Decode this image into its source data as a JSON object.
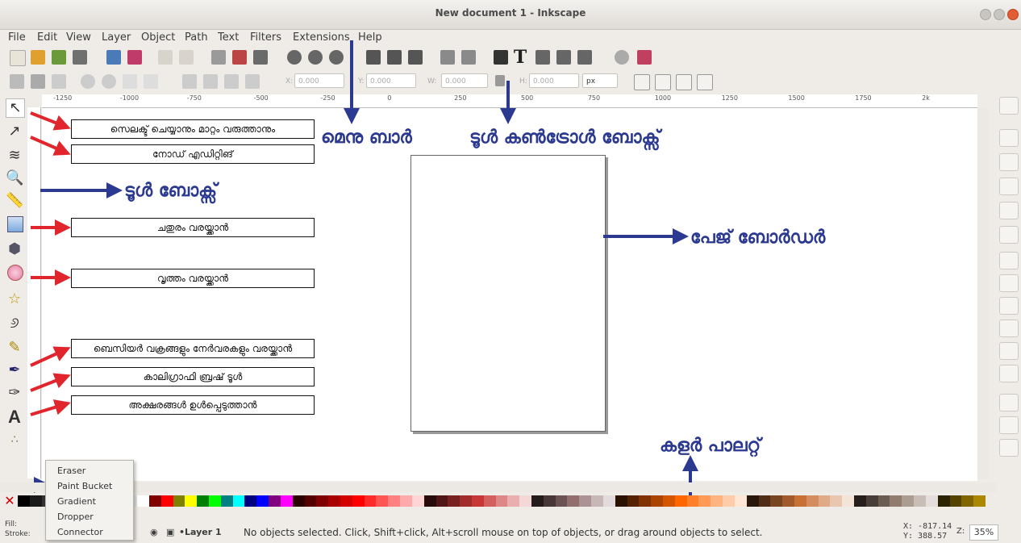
{
  "window": {
    "title": "New document 1 - Inkscape"
  },
  "menubar": {
    "items": [
      "File",
      "Edit",
      "View",
      "Layer",
      "Object",
      "Path",
      "Text",
      "Filters",
      "Extensions",
      "Help"
    ]
  },
  "controls": {
    "x_label": "X:",
    "x_value": "0.000",
    "y_label": "Y:",
    "y_value": "0.000",
    "w_label": "W:",
    "w_value": "0.000",
    "h_label": "H:",
    "h_value": "0.000",
    "unit": "px"
  },
  "ruler": {
    "ticks": [
      "-1250",
      "-1000",
      "-750",
      "-500",
      "-250",
      "0",
      "250",
      "500",
      "750",
      "1000",
      "1250",
      "1500",
      "1750",
      "2k"
    ]
  },
  "tool_labels": [
    "സെലക്ട് ചെയ്യാനും മാറ്റം വരുത്താനും",
    "നോഡ് എഡിറ്റിങ്",
    "ചതുരം വരയ്ക്കാൻ",
    "വൃത്തം വരയ്ക്കാൻ",
    "ബെസിയർ വക്രങ്ങളും നേർവരകളും വരയ്ക്കാൻ",
    "കാലിഗ്രാഫി ബ്രഷ് ടൂൾ",
    "അക്ഷരങ്ങൾ ഉൾപ്പെടുത്താൻ"
  ],
  "annotations": {
    "menu_bar": "മെനു ബാർ",
    "tool_controls": "ടൂൾ കൺട്രോൾ ബോക്സ്",
    "toolbox": "ടൂൾ ബോക്സ്",
    "page_border": "പേജ് ബോർഡർ",
    "color_palette": "കളർ പാലറ്റ്"
  },
  "popup_menu": {
    "items": [
      "Eraser",
      "Paint Bucket",
      "Gradient",
      "Dropper",
      "Connector"
    ]
  },
  "statusbar": {
    "fill_label": "Fill:",
    "stroke_label": "Stroke:",
    "layer": "•Layer 1",
    "message": "No objects selected. Click, Shift+click, Alt+scroll mouse on top of objects, or drag around objects to select.",
    "x_coord": "X: -817.14",
    "y_coord": "Y: 388.57",
    "zoom_label": "Z:",
    "zoom": "35%"
  },
  "palette_colors": [
    "#000000",
    "#1a1a1a",
    "#333333",
    "#4d4d4d",
    "#666666",
    "#808080",
    "#999999",
    "#b3b3b3",
    "#cccccc",
    "#e6e6e6",
    "#ffffff",
    "#800000",
    "#ff0000",
    "#808000",
    "#ffff00",
    "#008000",
    "#00ff00",
    "#008080",
    "#00ffff",
    "#000080",
    "#0000ff",
    "#800080",
    "#ff00ff",
    "#2b0000",
    "#550000",
    "#800000",
    "#aa0000",
    "#d40000",
    "#ff0000",
    "#ff2a2a",
    "#ff5555",
    "#ff8080",
    "#ffaaaa",
    "#ffd5d5",
    "#280b0b",
    "#501616",
    "#782121",
    "#a02c2c",
    "#c83737",
    "#d35f5f",
    "#de8787",
    "#e9afaf",
    "#f4d7d7",
    "#241c1c",
    "#483737",
    "#6c5353",
    "#916f6f",
    "#ac9393",
    "#c8b7b7",
    "#e3dbdb",
    "#2b1100",
    "#552200",
    "#803300",
    "#aa4400",
    "#d45500",
    "#ff6600",
    "#ff7f2a",
    "#ff9955",
    "#ffb380",
    "#ffccaa",
    "#ffe6d5",
    "#28170b",
    "#502d16",
    "#784421",
    "#a05a2c",
    "#c87137",
    "#d38d5f",
    "#deaa87",
    "#e9c6af",
    "#f4e3d7",
    "#241f1c",
    "#483e37",
    "#6c5d53",
    "#917c6f",
    "#ac9d93",
    "#c8beb7",
    "#e3dedb",
    "#2b2200",
    "#554400",
    "#806600",
    "#aa8800"
  ]
}
